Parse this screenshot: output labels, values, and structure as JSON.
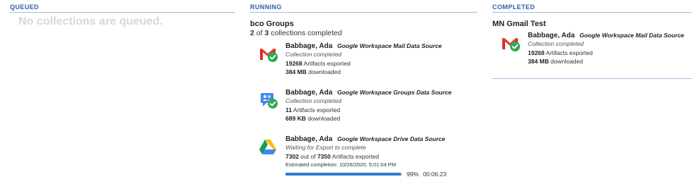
{
  "queued": {
    "header": "QUEUED",
    "empty_message": "No collections are queued."
  },
  "running": {
    "header": "RUNNING",
    "group_title": "bco Groups",
    "group_completed": "2",
    "group_of": "of",
    "group_total": "3",
    "group_suffix": "collections completed",
    "items": [
      {
        "icon": "gmail-icon",
        "user": "Babbage, Ada",
        "source": "Google Workspace Mail Data Source",
        "status": "Collection completed",
        "artifacts_count": "19268",
        "artifacts_label": "Artifacts exported",
        "downloaded_amount": "384 MB",
        "downloaded_label": "downloaded"
      },
      {
        "icon": "groups-icon",
        "user": "Babbage, Ada",
        "source": "Google Workspace Groups Data Source",
        "status": "Collection completed",
        "artifacts_count": "11",
        "artifacts_label": "Artifacts exported",
        "downloaded_amount": "689 KB",
        "downloaded_label": "downloaded"
      },
      {
        "icon": "drive-icon",
        "user": "Babbage, Ada",
        "source": "Google Workspace Drive Data Source",
        "status": "Waiting for Export to complete",
        "artifacts_done": "7302",
        "artifacts_out_of": "out of",
        "artifacts_total": "7350",
        "artifacts_label": "Artifacts exported",
        "estimated_completion": "Estimated completion: 10/26/2020, 5:01:04 PM",
        "progress_percent": 99,
        "progress_label": "99%",
        "elapsed": "00:06:23"
      }
    ]
  },
  "completed": {
    "header": "COMPLETED",
    "group_title": "MN Gmail Test",
    "items": [
      {
        "icon": "gmail-icon",
        "user": "Babbage, Ada",
        "source": "Google Workspace Mail Data Source",
        "status": "Collection completed",
        "artifacts_count": "19268",
        "artifacts_label": "Artifacts exported",
        "downloaded_amount": "384 MB",
        "downloaded_label": "downloaded"
      }
    ]
  },
  "colors": {
    "header_blue": "#2e5fa3",
    "divider_blue": "#9fbbe0",
    "progress_blue": "#2f7fd2",
    "check_green": "#34a853",
    "gmail_red": "#d93025"
  }
}
